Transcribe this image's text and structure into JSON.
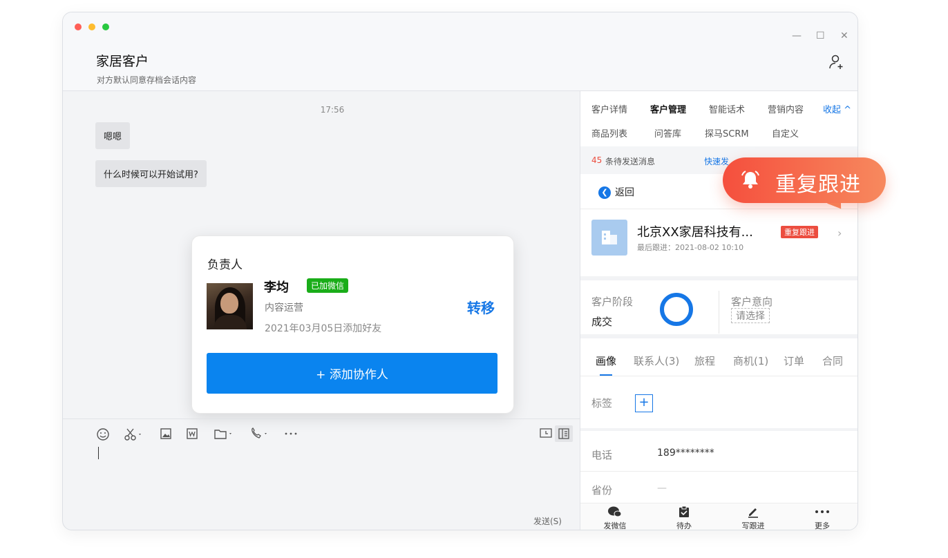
{
  "window": {
    "title": "家居客户",
    "subtitle": "对方默认同意存档会话内容",
    "controls": {
      "minimize": "—",
      "maximize": "☐",
      "close": "✕"
    },
    "traffic_colors": [
      "#ff5f57",
      "#febc2e",
      "#28c840"
    ]
  },
  "chat": {
    "timestamp": "17:56",
    "messages": [
      "嗯嗯",
      "什么时候可以开始试用?"
    ]
  },
  "owner_card": {
    "title": "负责人",
    "name": "李均",
    "wechat_badge": "已加微信",
    "role": "内容运营",
    "added_date": "2021年03月05日添加好友",
    "transfer_label": "转移",
    "add_collaborator_label": "+ 添加协作人"
  },
  "composer": {
    "send_label": "发送(S)"
  },
  "panel": {
    "tabs_row1": [
      "客户详情",
      "客户管理",
      "智能话术",
      "营销内容"
    ],
    "collapse_label": "收起 ^",
    "tabs_row2": [
      "商品列表",
      "问答库",
      "探马SCRM",
      "自定义"
    ],
    "pending_count": "45",
    "pending_text": "条待发送消息",
    "quick_send": "快速发",
    "back_label": "返回",
    "company_name": "北京XX家居科技有...",
    "last_follow": "最后跟进：2021-08-02 10:10",
    "repeat_tag": "重复跟进",
    "stage_label": "客户阶段",
    "stage_value": "成交",
    "intent_label": "客户意向",
    "intent_placeholder": "请选择",
    "detail_tabs": [
      "画像",
      "联系人(3)",
      "旅程",
      "商机(1)",
      "订单",
      "合同"
    ],
    "tag_label": "标签",
    "phone_label": "电话",
    "phone_value": "189********",
    "province_label": "省份",
    "province_value": "—",
    "bottom_actions": [
      "发微信",
      "待办",
      "写跟进",
      "更多"
    ]
  },
  "callout": {
    "text": "重复跟进"
  },
  "colors": {
    "accent_blue": "#1677e6",
    "button_blue": "#0a84ef",
    "wechat_green": "#1aad19",
    "alert_red": "#ec4d3f"
  }
}
